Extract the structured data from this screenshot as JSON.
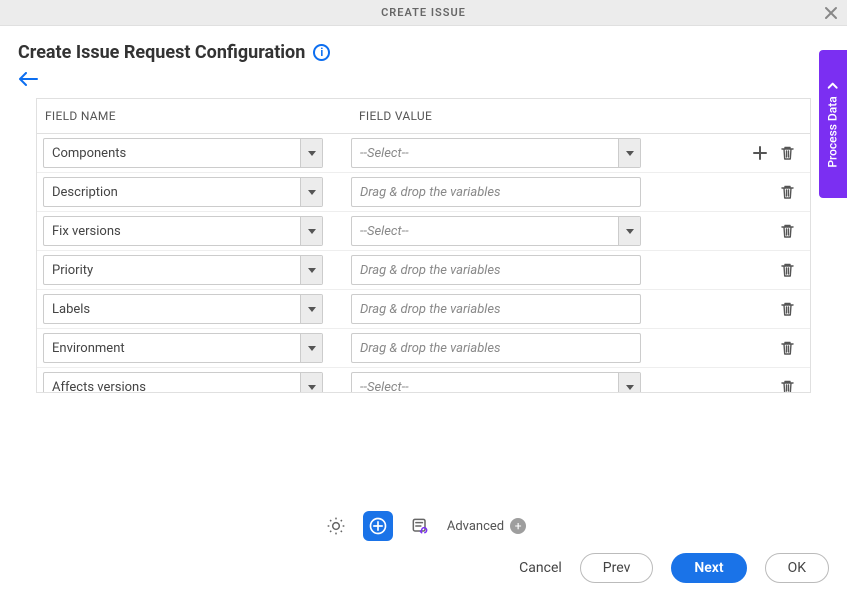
{
  "header": {
    "title": "CREATE ISSUE"
  },
  "page": {
    "title": "Create Issue Request Configuration"
  },
  "columns": {
    "name": "FIELD NAME",
    "value": "FIELD VALUE"
  },
  "placeholders": {
    "select": "--Select--",
    "drag": "Drag & drop the variables"
  },
  "rows": [
    {
      "name": "Components",
      "value_type": "select",
      "show_add": true
    },
    {
      "name": "Description",
      "value_type": "text",
      "show_add": false
    },
    {
      "name": "Fix versions",
      "value_type": "select",
      "show_add": false
    },
    {
      "name": "Priority",
      "value_type": "text",
      "show_add": false
    },
    {
      "name": "Labels",
      "value_type": "text",
      "show_add": false
    },
    {
      "name": "Environment",
      "value_type": "text",
      "show_add": false
    },
    {
      "name": "Affects versions",
      "value_type": "select",
      "show_add": false
    }
  ],
  "side_tab": {
    "label": "Process Data"
  },
  "toolbar": {
    "advanced_label": "Advanced"
  },
  "footer": {
    "cancel": "Cancel",
    "prev": "Prev",
    "next": "Next",
    "ok": "OK"
  }
}
